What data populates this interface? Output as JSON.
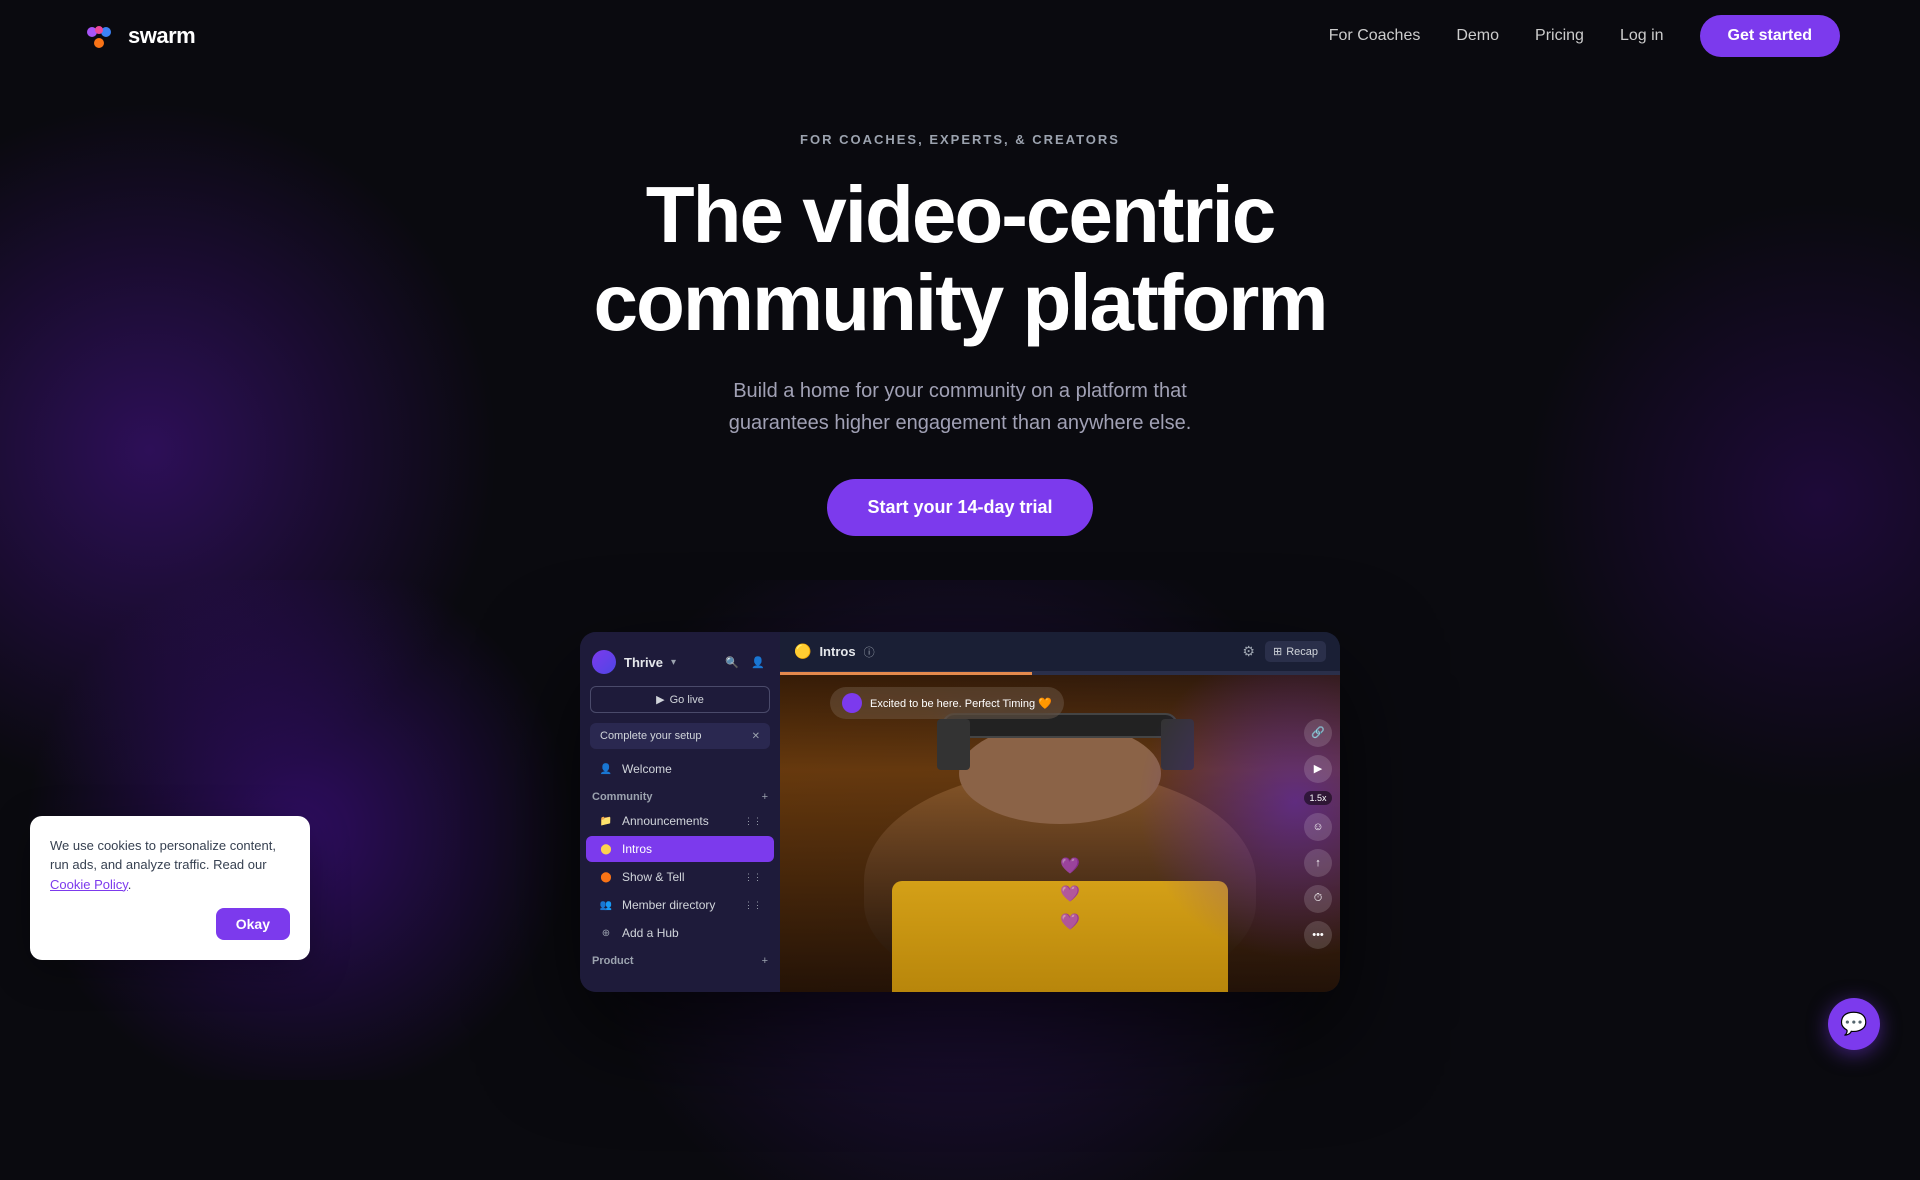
{
  "meta": {
    "title": "Swarm - The video-centric community platform"
  },
  "nav": {
    "logo_text": "swarm",
    "links": [
      {
        "id": "for-coaches",
        "label": "For Coaches"
      },
      {
        "id": "demo",
        "label": "Demo"
      },
      {
        "id": "pricing",
        "label": "Pricing"
      },
      {
        "id": "login",
        "label": "Log in"
      }
    ],
    "cta_label": "Get started"
  },
  "hero": {
    "eyebrow": "FOR COACHES, EXPERTS, & CREATORS",
    "title_line1": "The video-centric",
    "title_line2": "community platform",
    "subtitle": "Build a home for your community on a platform that\nguarantees higher engagement than anywhere else.",
    "cta_label": "Start your 14-day trial"
  },
  "app_preview": {
    "sidebar": {
      "community_name": "Thrive",
      "go_live_label": "Go live",
      "setup_label": "Complete your setup",
      "items": [
        {
          "id": "welcome",
          "label": "Welcome",
          "icon": "👤"
        },
        {
          "id": "community",
          "label": "Community",
          "is_section": true
        },
        {
          "id": "announcements",
          "label": "Announcements",
          "icon": "📁"
        },
        {
          "id": "intros",
          "label": "Intros",
          "icon": "🟡",
          "active": true
        },
        {
          "id": "show-tell",
          "label": "Show & Tell",
          "icon": "🟠"
        },
        {
          "id": "member-directory",
          "label": "Member directory",
          "icon": "👥"
        },
        {
          "id": "add-hub",
          "label": "Add a Hub",
          "icon": "➕"
        },
        {
          "id": "product",
          "label": "Product",
          "is_section": true
        }
      ]
    },
    "topbar": {
      "channel_name": "Intros",
      "recap_label": "Recap"
    },
    "video": {
      "comment_text": "Excited to be here. Perfect Timing 🧡",
      "speed_label": "1.5x",
      "progress_percent": 45
    }
  },
  "cookie": {
    "text": "We use cookies to personalize content, run ads, and analyze traffic. Read our ",
    "link_text": "Cookie Policy",
    "btn_label": "Okay"
  },
  "colors": {
    "accent": "#7c3aed",
    "bg_dark": "#0a0a0f",
    "sidebar_bg": "#1e1b3a"
  }
}
